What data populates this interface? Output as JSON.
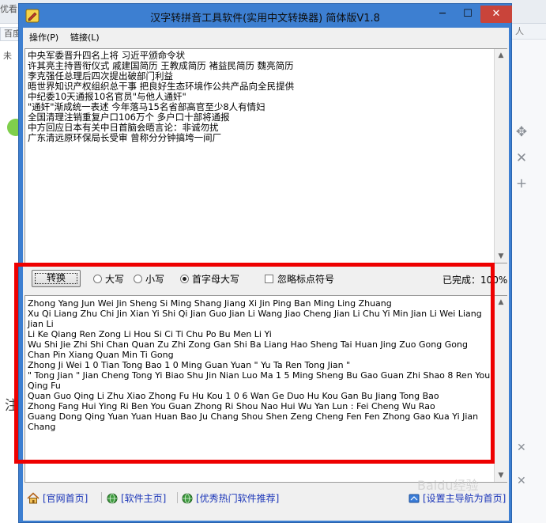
{
  "background": {
    "tab_label_a": "优看",
    "tab_label_b": "百度",
    "row3_label": "未",
    "right_tab_label": "人",
    "left_char": "注"
  },
  "window": {
    "title": "汉字转拼音工具软件(实用中文转换器) 简体版V1.8",
    "controls": {
      "minimize": "─",
      "maximize": "☐",
      "close": "✕"
    }
  },
  "menu": [
    "操作(P)",
    "链接(L)"
  ],
  "source_text": "中央军委晋升四名上将 习近平颁命令状\n许其亮主持晋衔仪式 戚建国简历 王教成简历 褚益民简历 魏亮简历\n李克强任总理后四次提出破部门利益\n晤世界知识产权组织总干事 把良好生态环境作公共产品向全民提供\n中纪委10天通报10名官员\"与他人通奸\"\n\"通奸\"渐成统一表述 今年落马15名省部高官至少8人有情妇\n全国清理注销重复户口106万个 多户口十部将通报\n中方回应日本有关中日首脑会晤言论：非诚勿扰\n广东清远原环保局长受审 曾称分分钟搞垮一间厂",
  "options": {
    "convert_button": "转换",
    "radio_upper": "大写",
    "radio_lower": "小写",
    "radio_capitalize": "首字母大写",
    "selected": "capitalize",
    "ignore_punct": "忽略标点符号",
    "ignore_punct_checked": false,
    "progress": "已完成：100%",
    "progress_percent": 100
  },
  "output_text": "Zhong Yang Jun Wei Jin Sheng Si Ming Shang Jiang   Xi Jin Ping Ban Ming Ling Zhuang\nXu Qi Liang Zhu Chi Jin Xian Yi Shi   Qi Jian Guo Jian Li   Wang Jiao Cheng Jian Li   Chu Yi Min Jian Li   Wei Liang Jian Li\nLi Ke Qiang Ren Zong Li Hou Si Ci Ti Chu Po Bu Men Li Yi\nWu Shi Jie Zhi Shi Chan Quan Zu Zhi Zong Gan Shi   Ba Liang Hao Sheng Tai Huan Jing Zuo Gong Gong Chan Pin Xiang Quan Min Ti Gong\nZhong Ji Wei 1 0 Tian Tong Bao 1 0 Ming Guan Yuan \" Yu Ta Ren Tong Jian \"\n\" Tong Jian \" Jian Cheng Tong Yi Biao Shu   Jin Nian Luo Ma 1 5 Ming Sheng Bu Gao Guan Zhi Shao 8 Ren You Qing Fu\nQuan Guo Qing Li Zhu Xiao Zhong Fu Hu Kou 1 0 6 Wan Ge   Duo Hu Kou Gan Bu Jiang Tong Bao\nZhong Fang Hui Ying Ri Ben You Guan Zhong Ri Shou Nao Hui Wu Yan Lun :   Fei Cheng Wu Rao\nGuang Dong Qing Yuan Yuan Huan Bao Ju Chang Shou Shen   Zeng Cheng Fen Fen Zhong Gao Kua Yi Jian Chang",
  "links": {
    "official_home": "[官网首页]",
    "software_home": "[软件主页]",
    "recommend": "[优秀热门软件推荐]",
    "set_home": "[设置主导航为首页]"
  },
  "colors": {
    "window_frame": "#3d7fd1",
    "close_button": "#c9443a",
    "link": "#1a35b8",
    "highlight_frame": "#ee0000"
  },
  "watermark": "Baidu经验"
}
